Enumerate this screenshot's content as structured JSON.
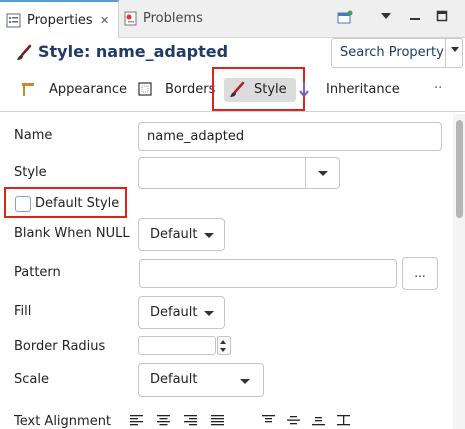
{
  "tabs": {
    "properties": "Properties",
    "properties_close": "✕",
    "problems": "Problems"
  },
  "header": {
    "title": "Style: name_adapted",
    "search_button": "Search Property"
  },
  "section_tabs": {
    "appearance": "Appearance",
    "borders": "Borders",
    "style": "Style",
    "inheritance": "Inheritance",
    "more": "··"
  },
  "form": {
    "name_label": "Name",
    "name_value": "name_adapted",
    "style_label": "Style",
    "style_value": "",
    "default_style_label": "Default Style",
    "default_style_checked": false,
    "blank_when_null_label": "Blank When NULL",
    "blank_when_null_value": "Default",
    "pattern_label": "Pattern",
    "pattern_value": "",
    "pattern_button": "...",
    "fill_label": "Fill",
    "fill_value": "Default",
    "border_radius_label": "Border Radius",
    "border_radius_value": "",
    "scale_label": "Scale",
    "scale_value": "Default",
    "text_alignment_label": "Text Alignment"
  },
  "colors": {
    "highlight": "#e0211c",
    "title": "#1f3b66",
    "active_tab_accent": "#5b9bd5"
  }
}
